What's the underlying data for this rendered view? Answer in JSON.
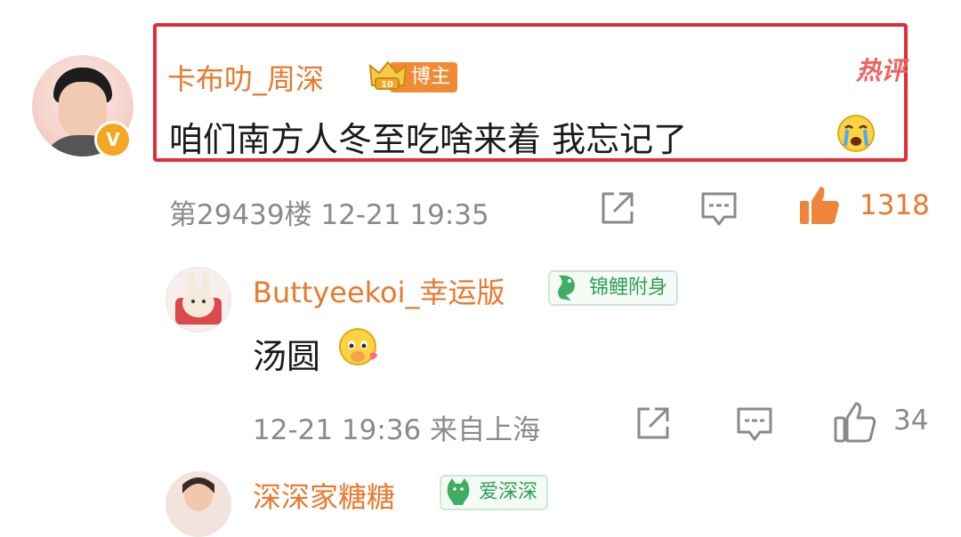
{
  "comments": [
    {
      "username": "卡布叻_周深",
      "badge": "博主",
      "hot_tag": "热评",
      "text": "咱们南方人冬至吃啥来着  我忘记了",
      "emoji": "crying-face-icon",
      "meta": "第29439楼 12-21 19:35",
      "likes": "1318",
      "liked": true
    },
    {
      "username": "Buttyeekoi_幸运版",
      "badge": "锦鲤附身",
      "text": "汤圆",
      "emoji": "blushing-face-icon",
      "meta": "12-21 19:36 来自上海",
      "likes": "34",
      "liked": false
    },
    {
      "username": "深深家糖糖",
      "badge": "爱深深"
    }
  ],
  "colors": {
    "username": "#e8792d",
    "highlight_border": "#e42c39",
    "meta_gray": "#8a8a8a",
    "badge_green": "#2f9e55",
    "blogger_badge": "#f08a35"
  }
}
